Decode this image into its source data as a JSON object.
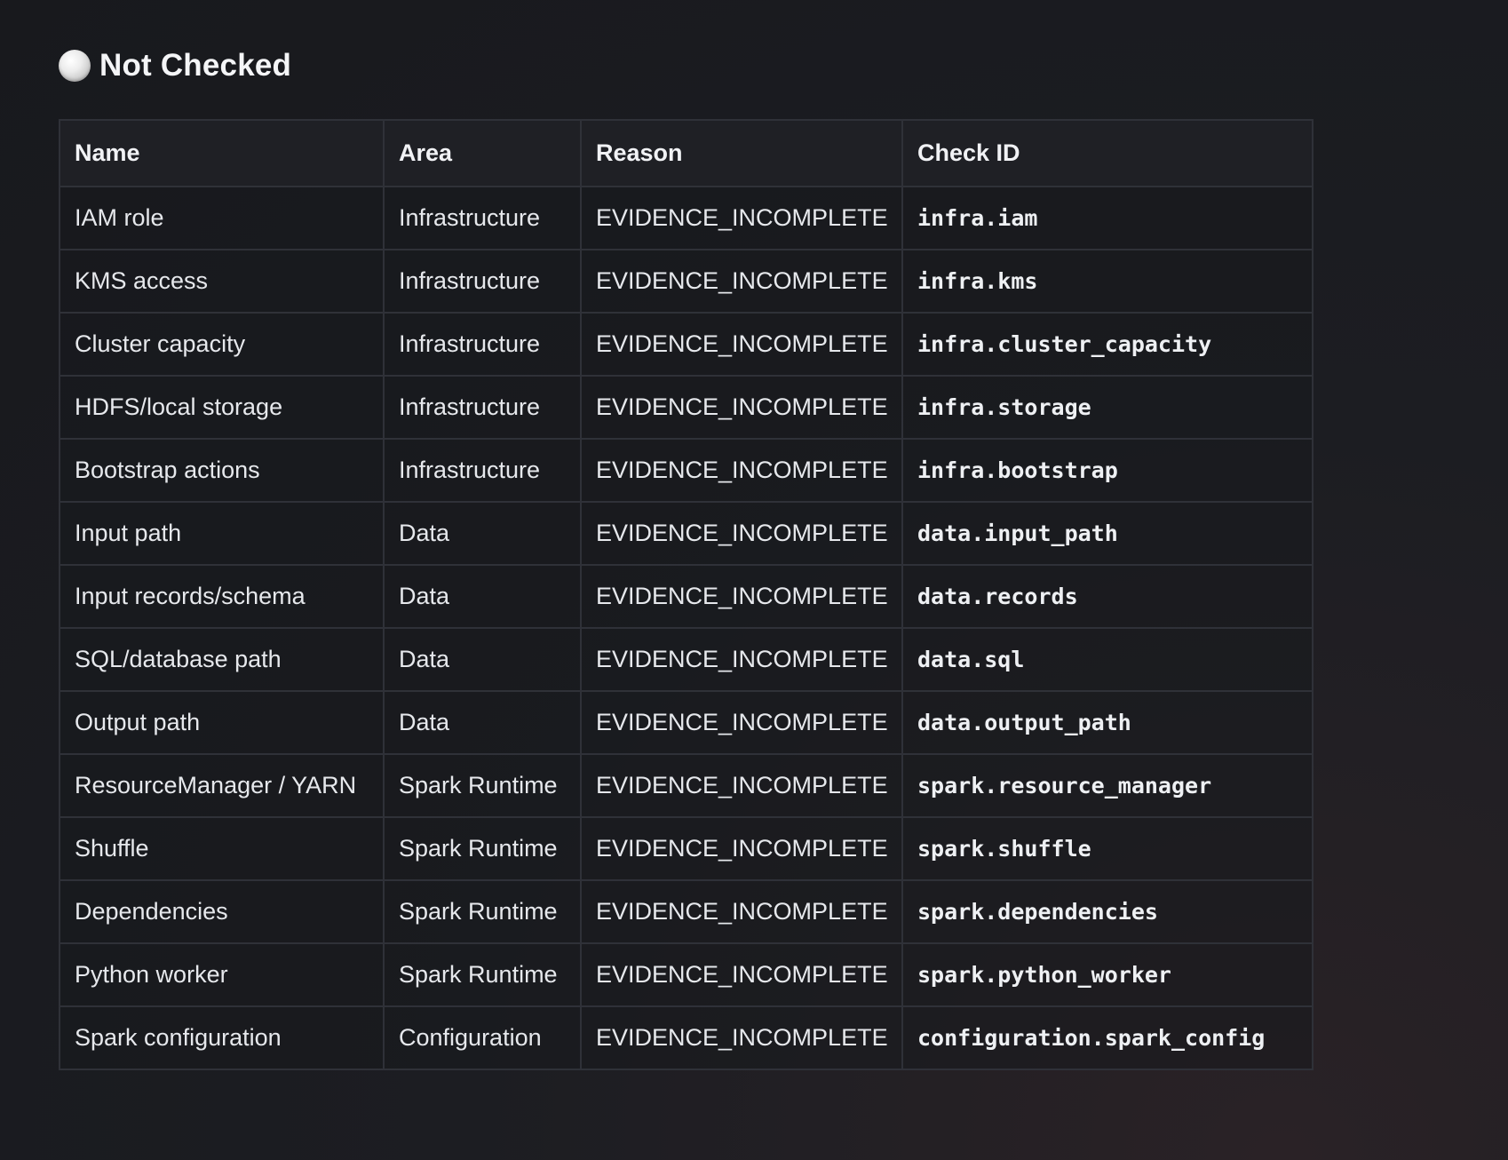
{
  "section": {
    "title": "Not Checked",
    "status_icon": "white-circle-icon",
    "status_color": "#e8e8e8"
  },
  "table": {
    "headers": [
      "Name",
      "Area",
      "Reason",
      "Check ID"
    ],
    "rows": [
      {
        "name": "IAM role",
        "area": "Infrastructure",
        "reason": "EVIDENCE_INCOMPLETE",
        "check_id": "infra.iam"
      },
      {
        "name": "KMS access",
        "area": "Infrastructure",
        "reason": "EVIDENCE_INCOMPLETE",
        "check_id": "infra.kms"
      },
      {
        "name": "Cluster capacity",
        "area": "Infrastructure",
        "reason": "EVIDENCE_INCOMPLETE",
        "check_id": "infra.cluster_capacity"
      },
      {
        "name": "HDFS/local storage",
        "area": "Infrastructure",
        "reason": "EVIDENCE_INCOMPLETE",
        "check_id": "infra.storage"
      },
      {
        "name": "Bootstrap actions",
        "area": "Infrastructure",
        "reason": "EVIDENCE_INCOMPLETE",
        "check_id": "infra.bootstrap"
      },
      {
        "name": "Input path",
        "area": "Data",
        "reason": "EVIDENCE_INCOMPLETE",
        "check_id": "data.input_path"
      },
      {
        "name": "Input records/schema",
        "area": "Data",
        "reason": "EVIDENCE_INCOMPLETE",
        "check_id": "data.records"
      },
      {
        "name": "SQL/database path",
        "area": "Data",
        "reason": "EVIDENCE_INCOMPLETE",
        "check_id": "data.sql"
      },
      {
        "name": "Output path",
        "area": "Data",
        "reason": "EVIDENCE_INCOMPLETE",
        "check_id": "data.output_path"
      },
      {
        "name": "ResourceManager / YARN",
        "area": "Spark Runtime",
        "reason": "EVIDENCE_INCOMPLETE",
        "check_id": "spark.resource_manager"
      },
      {
        "name": "Shuffle",
        "area": "Spark Runtime",
        "reason": "EVIDENCE_INCOMPLETE",
        "check_id": "spark.shuffle"
      },
      {
        "name": "Dependencies",
        "area": "Spark Runtime",
        "reason": "EVIDENCE_INCOMPLETE",
        "check_id": "spark.dependencies"
      },
      {
        "name": "Python worker",
        "area": "Spark Runtime",
        "reason": "EVIDENCE_INCOMPLETE",
        "check_id": "spark.python_worker"
      },
      {
        "name": "Spark configuration",
        "area": "Configuration",
        "reason": "EVIDENCE_INCOMPLETE",
        "check_id": "configuration.spark_config"
      }
    ]
  }
}
